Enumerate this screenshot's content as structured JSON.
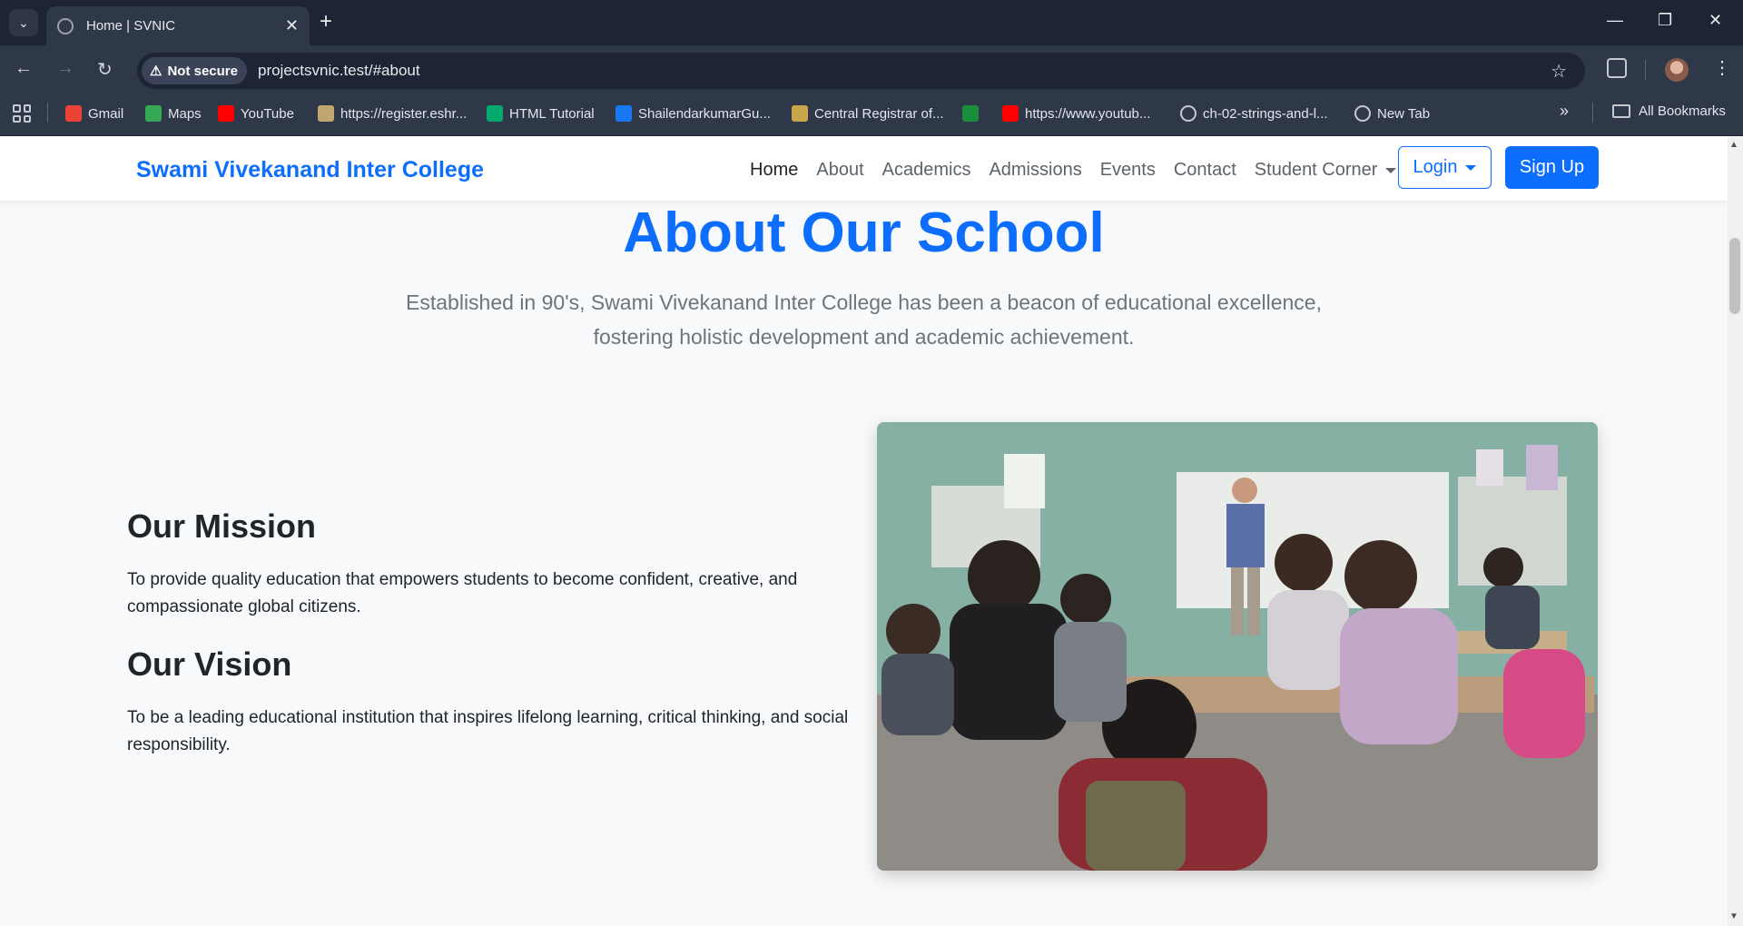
{
  "browser": {
    "tab_title": "Home | SVNIC",
    "security_label": "Not secure",
    "url": "projectsvnic.test/#about",
    "bookmarks": [
      {
        "label": "Gmail",
        "icon": "gmail-icon",
        "color": "#ea4335"
      },
      {
        "label": "Maps",
        "icon": "maps-icon",
        "color": "#34a853"
      },
      {
        "label": "YouTube",
        "icon": "youtube-icon",
        "color": "#ff0000"
      },
      {
        "label": "https://register.eshr...",
        "icon": "emblem-icon",
        "color": "#bfa76f"
      },
      {
        "label": "HTML Tutorial",
        "icon": "w3schools-icon",
        "color": "#04aa6d"
      },
      {
        "label": "ShailendarkumarGu...",
        "icon": "facebook-icon",
        "color": "#1877f2"
      },
      {
        "label": "Central Registrar of...",
        "icon": "seal-icon",
        "color": "#c9a64b"
      },
      {
        "label": "",
        "icon": "site-icon",
        "color": "#1a8f3b"
      },
      {
        "label": "https://www.youtub...",
        "icon": "youtube-icon",
        "color": "#ff0000"
      },
      {
        "label": "ch-02-strings-and-l...",
        "icon": "globe-icon",
        "color": "#c5c9d0"
      },
      {
        "label": "New Tab",
        "icon": "globe-icon",
        "color": "#c5c9d0"
      }
    ],
    "all_bookmarks_label": "All Bookmarks"
  },
  "site": {
    "brand": "Swami Vivekanand Inter College",
    "nav": {
      "home": "Home",
      "about": "About",
      "academics": "Academics",
      "admissions": "Admissions",
      "events": "Events",
      "contact": "Contact",
      "student_corner": "Student Corner"
    },
    "login_label": "Login",
    "signup_label": "Sign Up",
    "accent_color": "#0d6efd"
  },
  "about": {
    "title": "About Our School",
    "lead_line1": "Established in 90's, Swami Vivekanand Inter College has been a beacon of educational excellence,",
    "lead_line2": "fostering holistic development and academic achievement.",
    "mission_heading": "Our Mission",
    "mission_text": "To provide quality education that empowers students to become confident, creative, and compassionate global citizens.",
    "vision_heading": "Our Vision",
    "vision_text": "To be a leading educational institution that inspires lifelong learning, critical thinking, and social responsibility."
  }
}
